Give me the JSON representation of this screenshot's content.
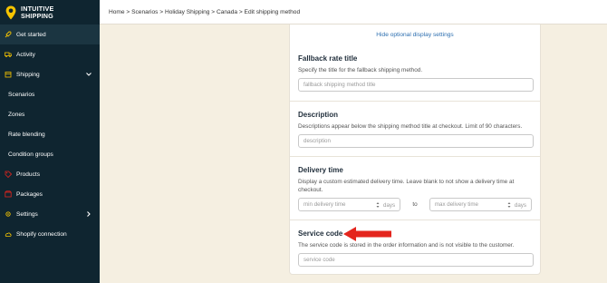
{
  "app": {
    "brand_line1": "INTUITIVE",
    "brand_line2": "SHIPPING"
  },
  "sidebar": {
    "items": [
      {
        "label": "Get started",
        "icon": "rocket-icon"
      },
      {
        "label": "Activity",
        "icon": "truck-icon"
      },
      {
        "label": "Shipping",
        "icon": "box-icon"
      },
      {
        "label": "Scenarios"
      },
      {
        "label": "Zones"
      },
      {
        "label": "Rate blending"
      },
      {
        "label": "Condition groups"
      },
      {
        "label": "Products",
        "icon": "tag-icon"
      },
      {
        "label": "Packages",
        "icon": "package-icon"
      },
      {
        "label": "Settings",
        "icon": "gear-icon"
      },
      {
        "label": "Shopify connection",
        "icon": "cloud-icon"
      }
    ]
  },
  "breadcrumb": {
    "text": "Home > Scenarios > Holiday Shipping > Canada > Edit shipping method"
  },
  "card": {
    "toggle_link": "Hide optional display settings",
    "fallback": {
      "title": "Fallback rate title",
      "desc": "Specify the title for the fallback shipping method.",
      "placeholder": "fallback shipping method title"
    },
    "description": {
      "title": "Description",
      "desc": "Descriptions appear below the shipping method title at checkout. Limit of 90 characters.",
      "placeholder": "description"
    },
    "delivery": {
      "title": "Delivery time",
      "desc": "Display a custom estimated delivery time. Leave blank to not show a delivery time at checkout.",
      "min_placeholder": "min delivery time",
      "max_placeholder": "max delivery time",
      "unit": "days",
      "to": "to"
    },
    "service": {
      "title": "Service code",
      "desc": "The service code is stored in the order information and is not visible to the customer.",
      "placeholder": "service code"
    }
  },
  "colors": {
    "sidebar_bg": "#0f2530",
    "accent": "#f5c400",
    "link": "#2d6fb0",
    "arrow": "#e4251d",
    "page_bg": "#f5efe1"
  }
}
